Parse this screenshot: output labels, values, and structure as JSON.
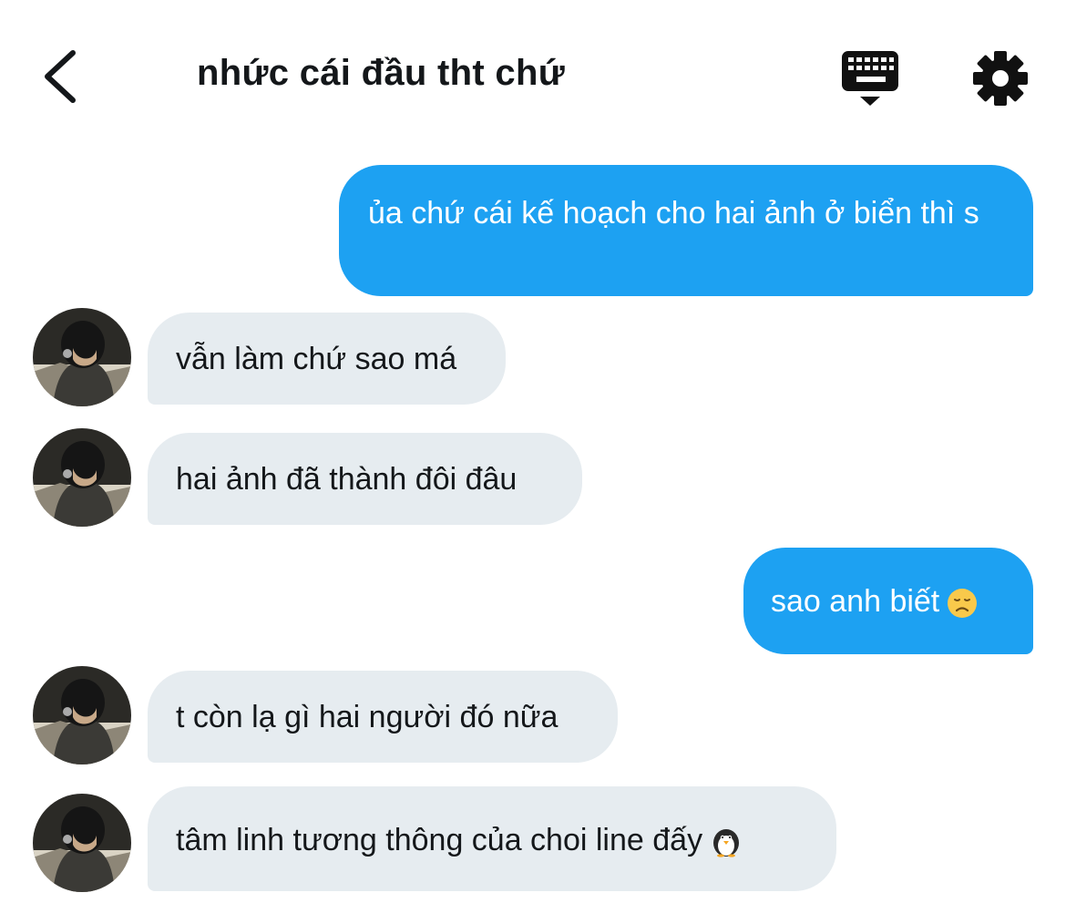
{
  "header": {
    "title": "nhức cái đầu tht chứ",
    "back_icon": "chevron-left-icon",
    "keyboard_icon": "keyboard-icon",
    "settings_icon": "gear-icon"
  },
  "colors": {
    "sent_bubble": "#1da1f2",
    "received_bubble": "#e6ecf0",
    "text_dark": "#14171a"
  },
  "messages": [
    {
      "direction": "sent",
      "text": "ủa chứ cái kế hoạch cho hai ảnh ở biển thì s"
    },
    {
      "direction": "received",
      "text": "vẫn làm chứ sao má"
    },
    {
      "direction": "received",
      "text": "hai ảnh đã thành đôi đâu"
    },
    {
      "direction": "sent",
      "text": "sao anh biết",
      "emoji": "disappointed-face-icon"
    },
    {
      "direction": "received",
      "text": "t còn lạ gì hai người đó nữa"
    },
    {
      "direction": "received",
      "text": "tâm linh tương thông của choi line đấy",
      "emoji": "penguin-icon"
    }
  ]
}
